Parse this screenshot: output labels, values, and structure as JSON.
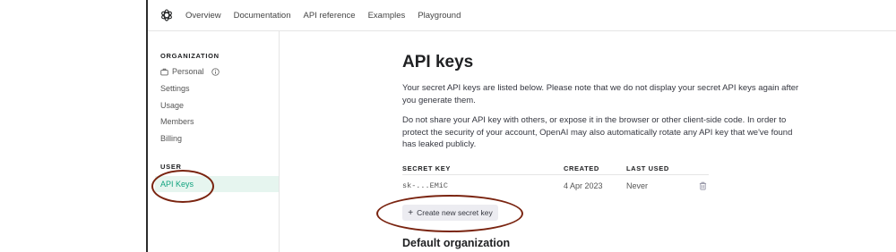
{
  "nav": {
    "links": [
      "Overview",
      "Documentation",
      "API reference",
      "Examples",
      "Playground"
    ]
  },
  "sidebar": {
    "org_heading": "ORGANIZATION",
    "org_name": "Personal",
    "org_items": [
      "Settings",
      "Usage",
      "Members",
      "Billing"
    ],
    "user_heading": "USER",
    "active_item": "API Keys"
  },
  "main": {
    "title": "API keys",
    "para1": "Your secret API keys are listed below. Please note that we do not display your secret API keys again after you generate them.",
    "para2": "Do not share your API key with others, or expose it in the browser or other client-side code. In order to protect the security of your account, OpenAI may also automatically rotate any API key that we've found has leaked publicly.",
    "table": {
      "headers": [
        "SECRET KEY",
        "CREATED",
        "LAST USED"
      ],
      "row": {
        "key": "sk-...EMiC",
        "created": "4 Apr 2023",
        "last_used": "Never"
      }
    },
    "create_button": "Create new secret key",
    "create_button_icon": "+",
    "section2_title": "Default organization"
  },
  "annotation_color": "#7a2410",
  "accent_color": "#10a37f"
}
